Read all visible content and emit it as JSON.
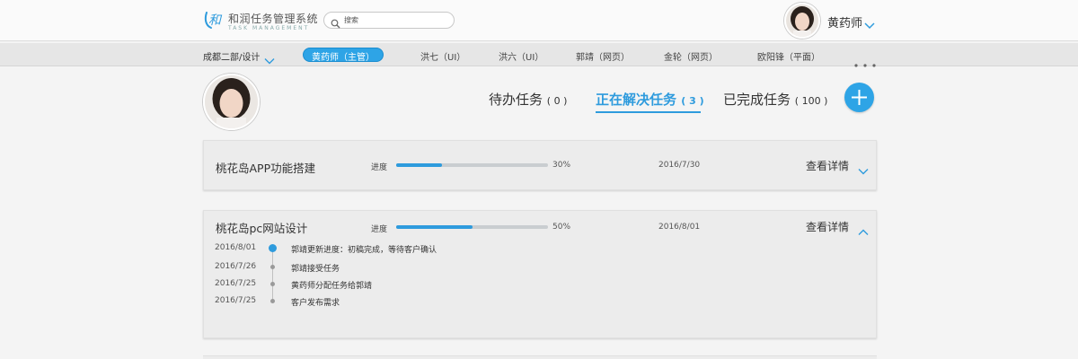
{
  "header": {
    "logo_char": "和",
    "app_title": "和润任务管理系统",
    "app_subtitle": "TASK MANAGEMENT",
    "search_placeholder": "搜索",
    "user_name": "黄药师"
  },
  "filter_bar": {
    "department": "成都二部/设计",
    "members": [
      {
        "label": "黄药师（主管）",
        "active": true
      },
      {
        "label": "洪七（UI）",
        "active": false
      },
      {
        "label": "洪六（UI）",
        "active": false
      },
      {
        "label": "郭靖（网页）",
        "active": false
      },
      {
        "label": "金轮（网页）",
        "active": false
      },
      {
        "label": "欧阳锋（平面）",
        "active": false
      }
    ]
  },
  "tabs": [
    {
      "label": "待办任务",
      "count": "( 0 )",
      "active": false
    },
    {
      "label": "正在解决任务",
      "count": "( 3 )",
      "active": true
    },
    {
      "label": "已完成任务",
      "count": "( 100 )",
      "active": false
    }
  ],
  "tasks": [
    {
      "title": "桃花岛APP功能搭建",
      "progress_label": "进度",
      "progress": 30,
      "progress_text": "30%",
      "date": "2016/7/30",
      "detail_label": "查看详情",
      "expanded": false
    },
    {
      "title": "桃花岛pc网站设计",
      "progress_label": "进度",
      "progress": 50,
      "progress_text": "50%",
      "date": "2016/8/01",
      "detail_label": "查看详情",
      "expanded": true,
      "timeline": [
        {
          "date": "2016/8/01",
          "text": "郭靖更新进度：初稿完成，等待客户确认",
          "current": true
        },
        {
          "date": "2016/7/26",
          "text": "郭靖接受任务",
          "current": false
        },
        {
          "date": "2016/7/25",
          "text": "黄药师分配任务给郭靖",
          "current": false
        },
        {
          "date": "2016/7/25",
          "text": "客户发布需求",
          "current": false
        }
      ]
    }
  ],
  "colors": {
    "accent": "#2e9bdd",
    "track": "#c9cdd0",
    "background": "#f4f4f4"
  }
}
